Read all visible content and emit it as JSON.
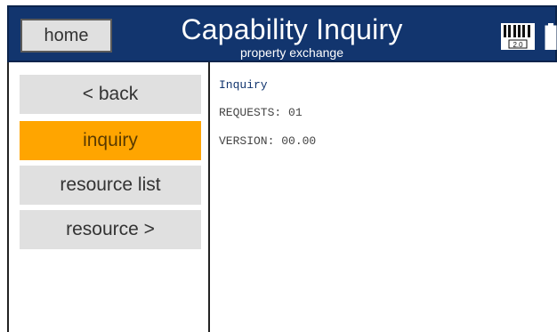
{
  "header": {
    "home_label": "home",
    "title": "Capability Inquiry",
    "subtitle": "property exchange",
    "logo_version": "2.0",
    "colors": {
      "bar": "#12356e",
      "text": "#ffffff"
    },
    "icons": [
      "midi-2.0-logo-icon",
      "battery-icon"
    ]
  },
  "sidebar": {
    "items": [
      {
        "label": "< back",
        "active": false
      },
      {
        "label": "inquiry",
        "active": true
      },
      {
        "label": "resource list",
        "active": false
      },
      {
        "label": "resource >",
        "active": false
      }
    ],
    "colors": {
      "button": "#e0e0e0",
      "active": "#ffa500"
    }
  },
  "content": {
    "heading": "Inquiry",
    "lines": [
      "REQUESTS: 01",
      "VERSION: 00.00"
    ]
  }
}
